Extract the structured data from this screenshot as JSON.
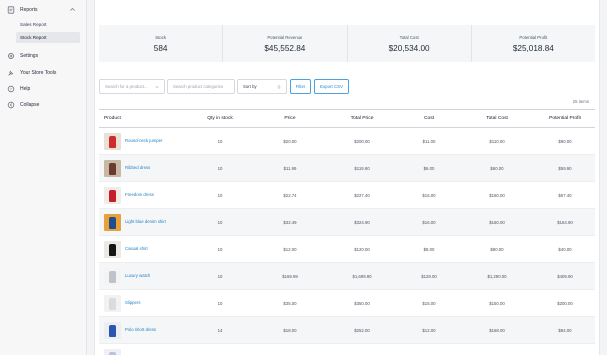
{
  "sidebar": {
    "reports": "Reports",
    "sub_items": [
      "Sales Report",
      "Stock Report"
    ],
    "active_sub": 1,
    "settings": "Settings",
    "store_tools": "Your Store Tools",
    "help": "Help",
    "collapse": "Collapse"
  },
  "stats": [
    {
      "label": "Stock",
      "value": "584"
    },
    {
      "label": "Potential Revenue",
      "value": "$45,552.84"
    },
    {
      "label": "Total Cost",
      "value": "$20,534.00"
    },
    {
      "label": "Potential Profit",
      "value": "$25,018.84"
    }
  ],
  "filters": {
    "product_placeholder": "Search for a product...",
    "category_placeholder": "Search product categories",
    "sort_label": "Sort by",
    "filter_button": "Filter",
    "export_button": "Export CSV"
  },
  "items_count": "25 items",
  "table": {
    "columns": [
      "Product",
      "Qty in stock",
      "Price",
      "Total Price",
      "Cost",
      "Total Cost",
      "Potential Profit"
    ],
    "rows": [
      {
        "name": "Round-neck jumper",
        "qty": "10",
        "price": "$20.00",
        "total_price": "$200.00",
        "cost": "$11.00",
        "total_cost": "$110.00",
        "profit": "$90.00",
        "thumb_color": "#d12c2c",
        "thumb_bg": "#e8e1d8"
      },
      {
        "name": "Ribbed dress",
        "qty": "10",
        "price": "$11.99",
        "total_price": "$119.90",
        "cost": "$6.00",
        "total_cost": "$60.00",
        "profit": "$59.90",
        "thumb_color": "#6b3a2e",
        "thumb_bg": "#c9b8a6"
      },
      {
        "name": "Freedom dress",
        "qty": "10",
        "price": "$22.74",
        "total_price": "$227.40",
        "cost": "$16.00",
        "total_cost": "$160.00",
        "profit": "$67.40",
        "thumb_color": "#c41f2a",
        "thumb_bg": "#f1ece6"
      },
      {
        "name": "Light blue denim shirt",
        "qty": "10",
        "price": "$32.49",
        "total_price": "$324.90",
        "cost": "$16.00",
        "total_cost": "$160.00",
        "profit": "$164.90",
        "thumb_color": "#1f4e8c",
        "thumb_bg": "#e8a03a"
      },
      {
        "name": "Casual shirt",
        "qty": "10",
        "price": "$12.00",
        "total_price": "$120.00",
        "cost": "$8.00",
        "total_cost": "$80.00",
        "profit": "$40.00",
        "thumb_color": "#151515",
        "thumb_bg": "#ece9e4"
      },
      {
        "name": "Luxury watch",
        "qty": "10",
        "price": "$169.99",
        "total_price": "$1,699.90",
        "cost": "$129.00",
        "total_cost": "$1,290.00",
        "profit": "$409.90",
        "thumb_color": "#bfc3c8",
        "thumb_bg": "#f4f4f4"
      },
      {
        "name": "Slippers",
        "qty": "10",
        "price": "$35.00",
        "total_price": "$350.00",
        "cost": "$15.00",
        "total_cost": "$150.00",
        "profit": "$200.00",
        "thumb_color": "#d9dbde",
        "thumb_bg": "#f2f2f2"
      },
      {
        "name": "Polo short dress",
        "qty": "14",
        "price": "$18.00",
        "total_price": "$252.00",
        "cost": "$12.00",
        "total_cost": "$168.00",
        "profit": "$84.00",
        "thumb_color": "#2a56b0",
        "thumb_bg": "#eceef2"
      },
      {
        "name": "",
        "qty": "",
        "price": "",
        "total_price": "",
        "cost": "",
        "total_cost": "",
        "profit": "",
        "thumb_color": "#b7c4dc",
        "thumb_bg": "#eef0f4"
      }
    ]
  }
}
